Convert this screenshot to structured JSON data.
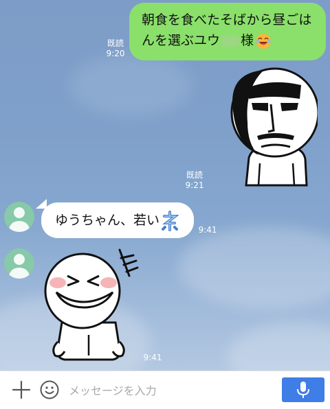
{
  "messages": {
    "outgoing": {
      "line1": "朝食を食べたそばから昼ごは",
      "line2_before": "んを選ぶユウ",
      "line2_after": "様",
      "emoji": "laughing-tears-emoji",
      "read_label": "既読",
      "time": "9:20"
    },
    "outgoing_sticker": {
      "sticker": "moai-face-sticker",
      "read_label": "既読",
      "time": "9:21"
    },
    "incoming": {
      "text": "ゆうちゃん、若い",
      "emoji": "ne-character-emoji",
      "time": "9:41"
    },
    "incoming_sticker": {
      "sticker": "moon-laughing-sticker",
      "time": "9:41"
    }
  },
  "input_bar": {
    "placeholder": "メッセージを入力",
    "icons": [
      "plus-icon",
      "smile-icon",
      "microphone-icon"
    ]
  },
  "colors": {
    "outgoing_bubble": "#8ae06a",
    "incoming_bubble": "#ffffff",
    "avatar": "#87c9a8",
    "mic_button": "#3f7de7"
  }
}
